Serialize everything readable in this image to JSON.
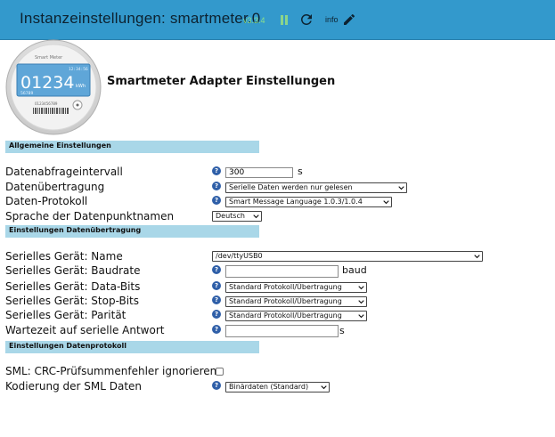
{
  "header": {
    "title": "Instanzeinstellungen: smartmeter.0",
    "version": "v3.3.4",
    "info": "info"
  },
  "logo": {
    "brand": "Smart Meter",
    "time": "12:34:56",
    "reading": "01234",
    "unit": "kWh",
    "subreading": "56789",
    "serial": "0123456789"
  },
  "page": {
    "heading": "Smartmeter Adapter Einstellungen"
  },
  "sections": {
    "general": "Allgemeine Einstellungen",
    "transfer": "Einstellungen Datenübertragung",
    "protocol": "Einstellungen Datenprotokoll"
  },
  "general": {
    "interval_label": "Datenabfrageintervall",
    "interval_value": "300",
    "interval_unit": "s",
    "transfer_label": "Datenübertragung",
    "transfer_value": "Serielle Daten werden nur gelesen",
    "protocol_label": "Daten-Protokoll",
    "protocol_value": "Smart Message Language 1.0.3/1.0.4",
    "language_label": "Sprache der Datenpunktnamen",
    "language_value": "Deutsch"
  },
  "transfer": {
    "device_label": "Serielles Gerät: Name",
    "device_value": "/dev/ttyUSB0",
    "baud_label": "Serielles Gerät: Baudrate",
    "baud_value": "",
    "baud_unit": "baud",
    "databits_label": "Serielles Gerät: Data-Bits",
    "databits_value": "Standard Protokoll/Übertragung",
    "stopbits_label": "Serielles Gerät: Stop-Bits",
    "stopbits_value": "Standard Protokoll/Übertragung",
    "parity_label": "Serielles Gerät: Parität",
    "parity_value": "Standard Protokoll/Übertragung",
    "wait_label": "Wartezeit auf serielle Antwort",
    "wait_value": "",
    "wait_unit": "s"
  },
  "protocol": {
    "crc_label": "SML: CRC-Prüfsummenfehler ignorieren",
    "crc_checked": false,
    "encoding_label": "Kodierung der SML Daten",
    "encoding_value": "Binärdaten (Standard)"
  },
  "colors": {
    "header_bg": "#3399cc",
    "section_bg": "#a9d7e8",
    "help_icon": "#2f5fa8",
    "version_text": "#8be08b"
  }
}
